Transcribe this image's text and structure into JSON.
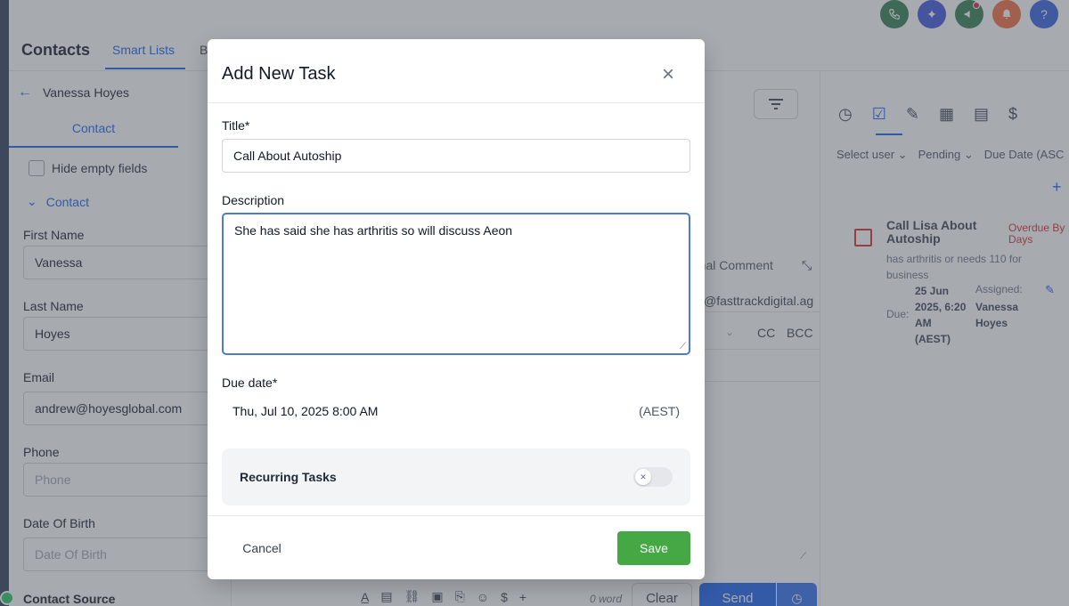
{
  "header": {
    "title": "Contacts",
    "tabs": [
      {
        "label": "Smart Lists"
      },
      {
        "label": "B"
      }
    ],
    "icon_colors": [
      "#2e7d4f",
      "#3b52d9",
      "#2e7d4f",
      "#f26b3a",
      "#2f5fe0"
    ]
  },
  "left": {
    "contact_name": "Vanessa Hoyes",
    "tab": "Contact",
    "hide_empty": "Hide empty fields",
    "section": "Contact",
    "fields": [
      {
        "label": "First Name",
        "value": "Vanessa",
        "placeholder": ""
      },
      {
        "label": "Last Name",
        "value": "Hoyes",
        "placeholder": ""
      },
      {
        "label": "Email",
        "value": "andrew@hoyesglobal.com",
        "placeholder": ""
      },
      {
        "label": "Phone",
        "value": "",
        "placeholder": "Phone"
      },
      {
        "label": "Date Of Birth",
        "value": "",
        "placeholder": "Date Of Birth"
      },
      {
        "label": "Contact Source",
        "value": "",
        "placeholder": ""
      }
    ]
  },
  "middle": {
    "internal_comment": "rnal Comment",
    "email_from": "@fasttrackdigital.ag",
    "cc": "CC",
    "bcc": "BCC",
    "word_count": "0 word",
    "clear": "Clear",
    "send": "Send"
  },
  "right": {
    "filters": [
      "Select user",
      "Pending",
      "Due Date (ASC"
    ],
    "task": {
      "title": "Call Lisa About Autoship",
      "overdue": "Overdue By 1 Days",
      "description": "has arthritis or needs 110 for business",
      "due_label": "Due:",
      "due_value": "25 Jun 2025, 6:20 AM (AEST)",
      "assigned_label": "Assigned:",
      "assigned_value": "Vanessa Hoyes"
    }
  },
  "modal": {
    "title": "Add New Task",
    "title_label": "Title*",
    "title_value": "Call About Autoship",
    "description_label": "Description",
    "description_value": "She has said she has arthritis so will discuss Aeon",
    "due_label": "Due date*",
    "due_value": "Thu, Jul 10, 2025 8:00 AM",
    "due_tz": "(AEST)",
    "recurring_label": "Recurring Tasks",
    "recurring_on": false,
    "cancel": "Cancel",
    "save": "Save"
  },
  "colors": {
    "accent": "#155eef",
    "save": "#45a845",
    "overdue": "#dc2626"
  }
}
